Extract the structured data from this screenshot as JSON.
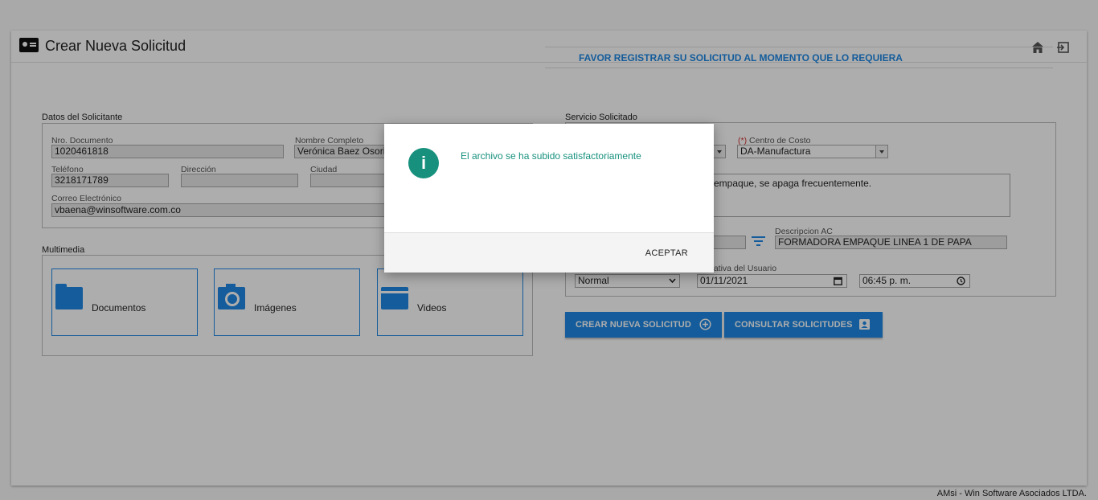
{
  "header": {
    "title": "Crear Nueva Solicitud",
    "icons": [
      "id-card-icon",
      "home-icon",
      "exit-icon"
    ]
  },
  "banner": "FAVOR REGISTRAR SU SOLICITUD AL MOMENTO QUE LO REQUIERA",
  "solicitante": {
    "section_label": "Datos del Solicitante",
    "nro_documento_label": "Nro. Documento",
    "nro_documento": "1020461818",
    "nombre_label": "Nombre Completo",
    "nombre": "Verónica Baez Osorio",
    "telefono_label": "Teléfono",
    "telefono": "3218171789",
    "direccion_label": "Dirección",
    "direccion": "",
    "ciudad_label": "Ciudad",
    "ciudad": "",
    "correo_label": "Correo Electrónico",
    "correo": "vbaena@winsoftware.com.co"
  },
  "servicio": {
    "section_label": "Servicio Solicitado",
    "req_mark": "(*)",
    "centro_costo_label": "Centro de Costo",
    "centro_costo": "DA-Manufactura",
    "descripcion_text": "empaque, se apaga frecuentemente.",
    "descripcion_ac_label": "Descripcion AC",
    "descripcion_ac": "FORMADORA EMPAQUE LINEA 1 DE PAPA",
    "fecha_label": "Tentativa del Usuario",
    "prioridad": "Normal",
    "fecha": "01/11/2021",
    "hora": "06:45 p. m."
  },
  "multimedia": {
    "section_label": "Multimedia",
    "items": [
      {
        "label": "Documentos",
        "icon": "folder-icon"
      },
      {
        "label": "Imágenes",
        "icon": "camera-icon"
      },
      {
        "label": "Videos",
        "icon": "video-icon"
      }
    ]
  },
  "buttons": {
    "crear": "CREAR NUEVA SOLICITUD",
    "consultar": "CONSULTAR SOLICITUDES"
  },
  "footer": "AMsi - Win Software Asociados LTDA.",
  "modal": {
    "message": "El archivo se ha subido satisfactoriamente",
    "icon_glyph": "i",
    "ok_label": "ACEPTAR"
  },
  "colors": {
    "accent": "#1e88e5",
    "success": "#17917e",
    "required": "#d32f2f"
  }
}
